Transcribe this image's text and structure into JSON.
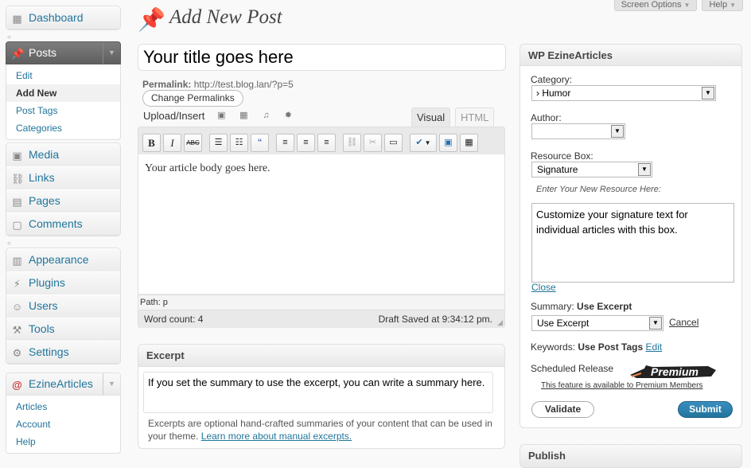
{
  "top_tabs": {
    "screen_options": "Screen Options",
    "help": "Help"
  },
  "sidebar": {
    "dashboard": "Dashboard",
    "posts": "Posts",
    "posts_sub": [
      "Edit",
      "Add New",
      "Post Tags",
      "Categories"
    ],
    "media": "Media",
    "links": "Links",
    "pages": "Pages",
    "comments": "Comments",
    "appearance": "Appearance",
    "plugins": "Plugins",
    "users": "Users",
    "tools": "Tools",
    "settings": "Settings",
    "ezine": "EzineArticles",
    "ezine_sub": [
      "Articles",
      "Account",
      "Help"
    ]
  },
  "page": {
    "title": "Add New Post",
    "post_title": "Your title goes here",
    "permalink_label": "Permalink:",
    "permalink_url": "http://test.blog.lan/?p=5",
    "change_permalinks": "Change Permalinks",
    "upload_insert": "Upload/Insert",
    "tab_visual": "Visual",
    "tab_html": "HTML"
  },
  "editor": {
    "body": "Your article body goes here.",
    "path": "Path: p",
    "word_count": "Word count: 4",
    "draft_saved": "Draft Saved at 9:34:12 pm."
  },
  "excerpt": {
    "heading": "Excerpt",
    "text": "If you set the summary to use the excerpt, you can write a summary here.",
    "help": "Excerpts are optional hand-crafted summaries of your content that can be used in your theme.",
    "help_link": "Learn more about manual excerpts."
  },
  "ezine_panel": {
    "heading": "WP EzineArticles",
    "category_label": "Category:",
    "category_value": "› Humor",
    "author_label": "Author:",
    "author_value": "",
    "resource_label": "Resource Box:",
    "resource_value": "Signature",
    "new_resource_hint": "Enter Your New Resource Here:",
    "resource_text": "Customize your signature text for individual articles with this box.",
    "close": "Close",
    "summary_label": "Summary:",
    "summary_current": "Use Excerpt",
    "summary_select": "Use Excerpt",
    "cancel": "Cancel",
    "keywords_label": "Keywords:",
    "keywords_current": "Use Post Tags",
    "keywords_edit": "Edit",
    "scheduled_label": "Scheduled Release",
    "premium_badge": "Premium",
    "premium_note": "This feature is available to Premium Members",
    "validate": "Validate",
    "submit": "Submit"
  },
  "publish": {
    "heading": "Publish"
  }
}
